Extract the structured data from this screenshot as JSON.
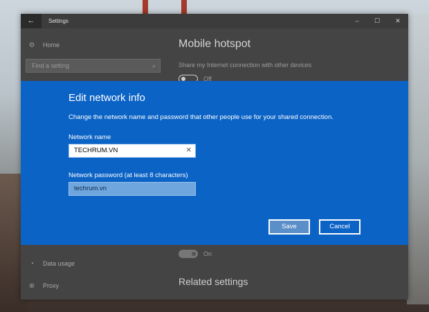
{
  "window": {
    "title": "Settings",
    "back_glyph": "←",
    "minimize_glyph": "–",
    "maximize_glyph": "☐",
    "close_glyph": "✕"
  },
  "sidebar": {
    "home_label": "Home",
    "search_placeholder": "Find a setting",
    "items": [
      {
        "label": "Data usage",
        "icon": "data-usage-icon"
      },
      {
        "label": "Proxy",
        "icon": "globe-icon"
      }
    ]
  },
  "content": {
    "title": "Mobile hotspot",
    "share_text": "Share my Internet connection with other devices",
    "share_toggle_state": "Off",
    "lower_toggle_state": "On",
    "related_heading": "Related settings"
  },
  "dialog": {
    "title": "Edit network info",
    "description": "Change the network name and password that other people use for your shared connection.",
    "name_label": "Network name",
    "name_value": "TECHRUM.VN",
    "password_label": "Network password (at least 8 characters)",
    "password_value": "techrum.vn",
    "save_label": "Save",
    "cancel_label": "Cancel",
    "accent_color": "#0b63c5"
  }
}
